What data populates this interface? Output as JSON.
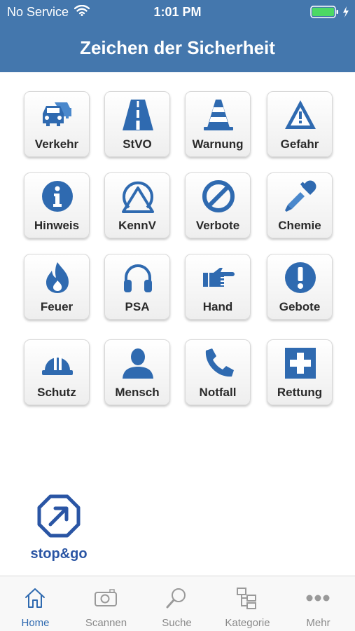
{
  "status": {
    "carrier": "No Service",
    "time": "1:01 PM"
  },
  "header": {
    "title": "Zeichen der Sicherheit"
  },
  "colors": {
    "accent": "#2f6ab0",
    "header_bg": "#4477ad",
    "battery": "#4cd964"
  },
  "categories": [
    {
      "label": "Verkehr",
      "icon": "cars-icon"
    },
    {
      "label": "StVO",
      "icon": "road-icon"
    },
    {
      "label": "Warnung",
      "icon": "traffic-cone-icon"
    },
    {
      "label": "Gefahr",
      "icon": "warning-triangle-icon"
    },
    {
      "label": "Hinweis",
      "icon": "info-icon"
    },
    {
      "label": "KennV",
      "icon": "triangle-circle-icon"
    },
    {
      "label": "Verbote",
      "icon": "prohibition-icon"
    },
    {
      "label": "Chemie",
      "icon": "pipette-icon"
    },
    {
      "label": "Feuer",
      "icon": "flame-icon"
    },
    {
      "label": "PSA",
      "icon": "headphones-icon"
    },
    {
      "label": "Hand",
      "icon": "pointing-hand-icon"
    },
    {
      "label": "Gebote",
      "icon": "exclamation-circle-icon"
    },
    {
      "label": "Schutz",
      "icon": "hard-hat-icon"
    },
    {
      "label": "Mensch",
      "icon": "person-icon"
    },
    {
      "label": "Notfall",
      "icon": "phone-icon"
    },
    {
      "label": "Rettung",
      "icon": "first-aid-cross-icon"
    }
  ],
  "logo": {
    "text": "stop&go"
  },
  "tabs": [
    {
      "label": "Home",
      "icon": "home-icon",
      "active": true
    },
    {
      "label": "Scannen",
      "icon": "camera-icon",
      "active": false
    },
    {
      "label": "Suche",
      "icon": "search-icon",
      "active": false
    },
    {
      "label": "Kategorie",
      "icon": "category-tree-icon",
      "active": false
    },
    {
      "label": "Mehr",
      "icon": "more-dots-icon",
      "active": false
    }
  ]
}
